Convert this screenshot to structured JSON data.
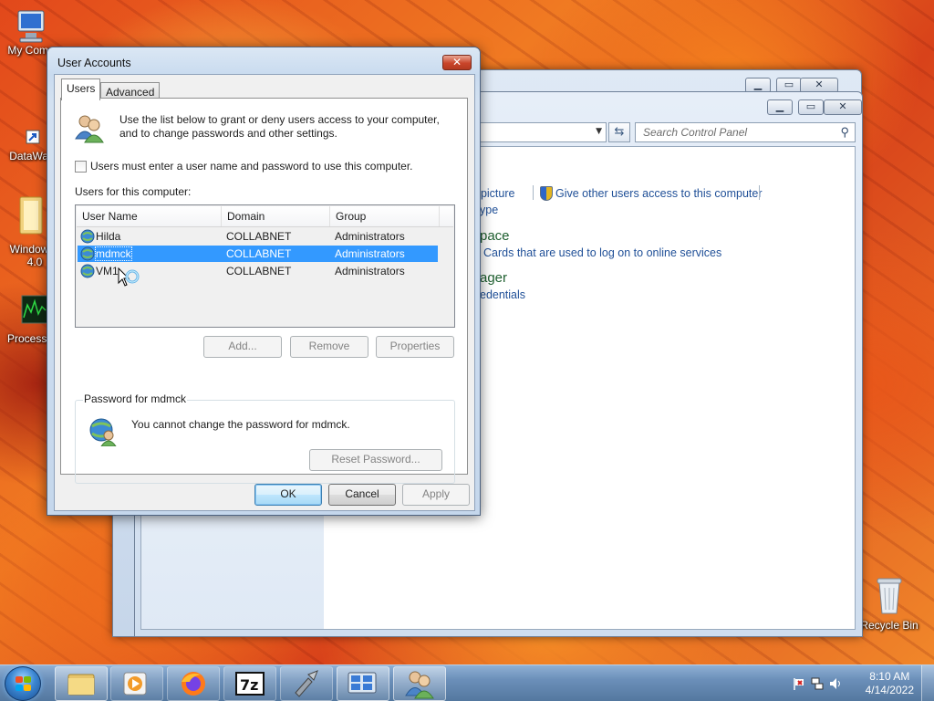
{
  "desktop": {
    "icons": [
      {
        "label": "My Comp",
        "icon": "computer-icon"
      },
      {
        "label": "DataWag",
        "icon": "shortcut-icon"
      },
      {
        "label": "Window",
        "label2": "4.0",
        "icon": "folder-icon"
      },
      {
        "label": "ProcessH",
        "icon": "monitor-graph-icon"
      },
      {
        "label": "Recycle Bin",
        "icon": "recycle-bin-icon"
      }
    ]
  },
  "control_panel": {
    "search_placeholder": "Search Control Panel",
    "links": {
      "picture": "t picture",
      "give_access": "Give other users access to this computer",
      "type": "ype",
      "cards": "Cards that are used to log on to online services",
      "credentials": "edentials"
    },
    "headings": {
      "space": "pace",
      "manager": "ager"
    }
  },
  "dialog": {
    "title": "User Accounts",
    "close_glyph": "✕",
    "tabs": [
      "Users",
      "Advanced"
    ],
    "intro_line1": "Use the list below to grant or deny users access to your computer,",
    "intro_line2": "and to change passwords and other settings.",
    "checkbox_label": "Users must enter a user name and password to use this computer.",
    "checkbox_checked": false,
    "list_label": "Users for this computer:",
    "columns": [
      "User Name",
      "Domain",
      "Group"
    ],
    "users": [
      {
        "name": "Hilda",
        "domain": "COLLABNET",
        "group": "Administrators"
      },
      {
        "name": "mdmck",
        "domain": "COLLABNET",
        "group": "Administrators"
      },
      {
        "name": "VM1",
        "domain": "COLLABNET",
        "group": "Administrators"
      }
    ],
    "selected_user_index": 1,
    "buttons": {
      "add": "Add...",
      "remove": "Remove",
      "properties": "Properties"
    },
    "password_group_title": "Password for mdmck",
    "password_message": "You cannot change the password for mdmck.",
    "reset_password": "Reset Password...",
    "ok": "OK",
    "cancel": "Cancel",
    "apply": "Apply"
  },
  "taskbar": {
    "time": "8:10 AM",
    "date": "4/14/2022",
    "items": [
      "file-explorer-icon",
      "media-player-icon",
      "firefox-icon",
      "7zip-icon",
      "tool-icon",
      "control-panel-icon",
      "user-accounts-icon"
    ]
  },
  "colors": {
    "selection": "#3399ff",
    "link": "#1f4f97",
    "heading_green": "#1e5f2f",
    "taskbar": "#6b8fb9"
  }
}
